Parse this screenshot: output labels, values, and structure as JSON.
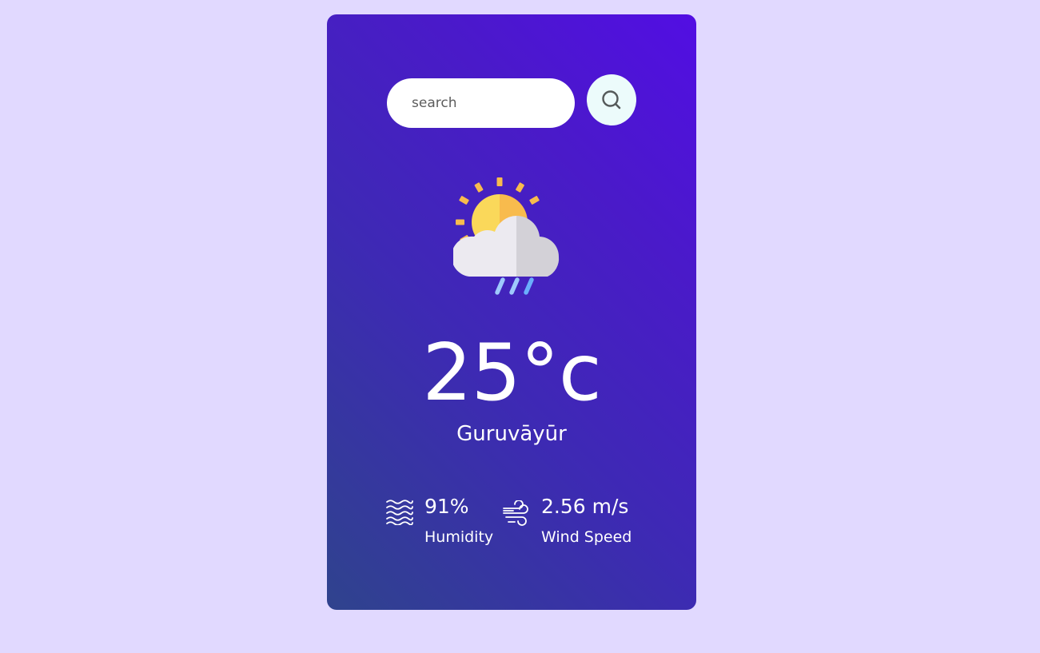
{
  "search": {
    "placeholder": "search",
    "value": "",
    "button_icon": "search-icon"
  },
  "weather": {
    "icon": "sun-cloud-rain-icon",
    "temperature": "25°c",
    "city": "Guruvāyūr"
  },
  "details": {
    "humidity": {
      "icon": "humidity-icon",
      "value": "91%",
      "label": "Humidity"
    },
    "wind": {
      "icon": "wind-icon",
      "value": "2.56 m/s",
      "label": "Wind Speed"
    }
  },
  "colors": {
    "page_background": "#e1d9ff",
    "card_gradient_start": "#520ee3",
    "card_gradient_end": "#2f438d",
    "search_button_bg": "#ecfbfb",
    "sun_yellow": "#fad85a",
    "sun_orange": "#f8bb4d",
    "cloud_light": "#eceaf0",
    "cloud_dark": "#d3d1d7",
    "rain_blue": "#6aaefc"
  }
}
